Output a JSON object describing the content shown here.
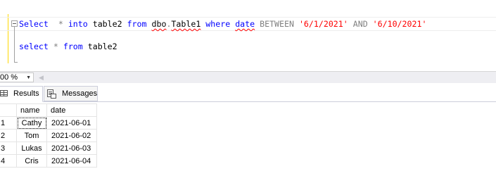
{
  "editor": {
    "line1": {
      "t1": "Select",
      "t2": "  * ",
      "t3": "into",
      "t4": " table2 ",
      "t5": "from",
      "t6": " ",
      "t7": "dbo",
      "t8": ".",
      "t9": "Table1",
      "t10": " ",
      "t11": "where",
      "t12": " ",
      "t13": "date",
      "t14": " BETWEEN ",
      "t15": "'6/1/2021'",
      "t16": " AND ",
      "t17": "'6/10/2021'"
    },
    "line2": {
      "t1": "select",
      "t2": " * ",
      "t3": "from",
      "t4": " table2"
    }
  },
  "zoom": {
    "value": "00 %"
  },
  "tabs": [
    {
      "label": "Results",
      "icon": "grid-icon"
    },
    {
      "label": "Messages",
      "icon": "messages-icon"
    }
  ],
  "results": {
    "columns": [
      "name",
      "date"
    ],
    "rows": [
      {
        "num": "1",
        "name": "Cathy",
        "date": "2021-06-01"
      },
      {
        "num": "2",
        "name": "Tom",
        "date": "2021-06-02"
      },
      {
        "num": "3",
        "name": "Lukas",
        "date": "2021-06-03"
      },
      {
        "num": "4",
        "name": "Cris",
        "date": "2021-06-04"
      }
    ]
  },
  "colors": {
    "keyword": "#0000ff",
    "string": "#ff0000",
    "operator_gray": "#808080",
    "toolbar_bg": "#eeeef2"
  }
}
